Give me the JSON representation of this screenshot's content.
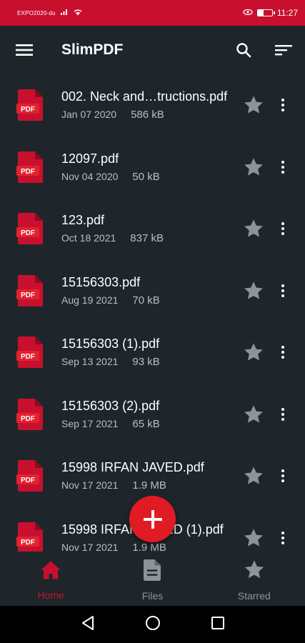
{
  "status_bar": {
    "carrier": "EXPO2020-du",
    "time": "11:27",
    "battery_level": 0.4,
    "background": "#c8102e"
  },
  "app_bar": {
    "title": "SlimPDF",
    "icons": [
      "menu-icon",
      "search-icon",
      "sort-icon"
    ]
  },
  "files": [
    {
      "name": "002. Neck and…tructions.pdf",
      "date": "Jan 07 2020",
      "size": "586 kB"
    },
    {
      "name": "12097.pdf",
      "date": "Nov 04 2020",
      "size": "50 kB"
    },
    {
      "name": "123.pdf",
      "date": "Oct 18 2021",
      "size": "837 kB"
    },
    {
      "name": "15156303.pdf",
      "date": "Aug 19 2021",
      "size": "70 kB"
    },
    {
      "name": "15156303 (1).pdf",
      "date": "Sep 13 2021",
      "size": "93 kB"
    },
    {
      "name": "15156303 (2).pdf",
      "date": "Sep 17 2021",
      "size": "65 kB"
    },
    {
      "name": "15998 IRFAN JAVED.pdf",
      "date": "Nov 17 2021",
      "size": "1.9 MB"
    },
    {
      "name": "15998 IRFAN JAVED (1).pdf",
      "date": "Nov 17 2021",
      "size": "1.9 MB"
    }
  ],
  "pdf_icon_label": "PDF",
  "fab": {
    "icon": "plus-icon",
    "color": "#e01b24"
  },
  "bottom_nav": {
    "items": [
      {
        "label": "Home",
        "icon": "home-icon",
        "active": true
      },
      {
        "label": "Files",
        "icon": "file-icon",
        "active": false
      },
      {
        "label": "Starred",
        "icon": "star-icon",
        "active": false
      }
    ],
    "active_color": "#c8102e",
    "inactive_color": "#8c949a"
  },
  "system_nav": [
    "back-icon",
    "home-circle-icon",
    "recents-icon"
  ]
}
